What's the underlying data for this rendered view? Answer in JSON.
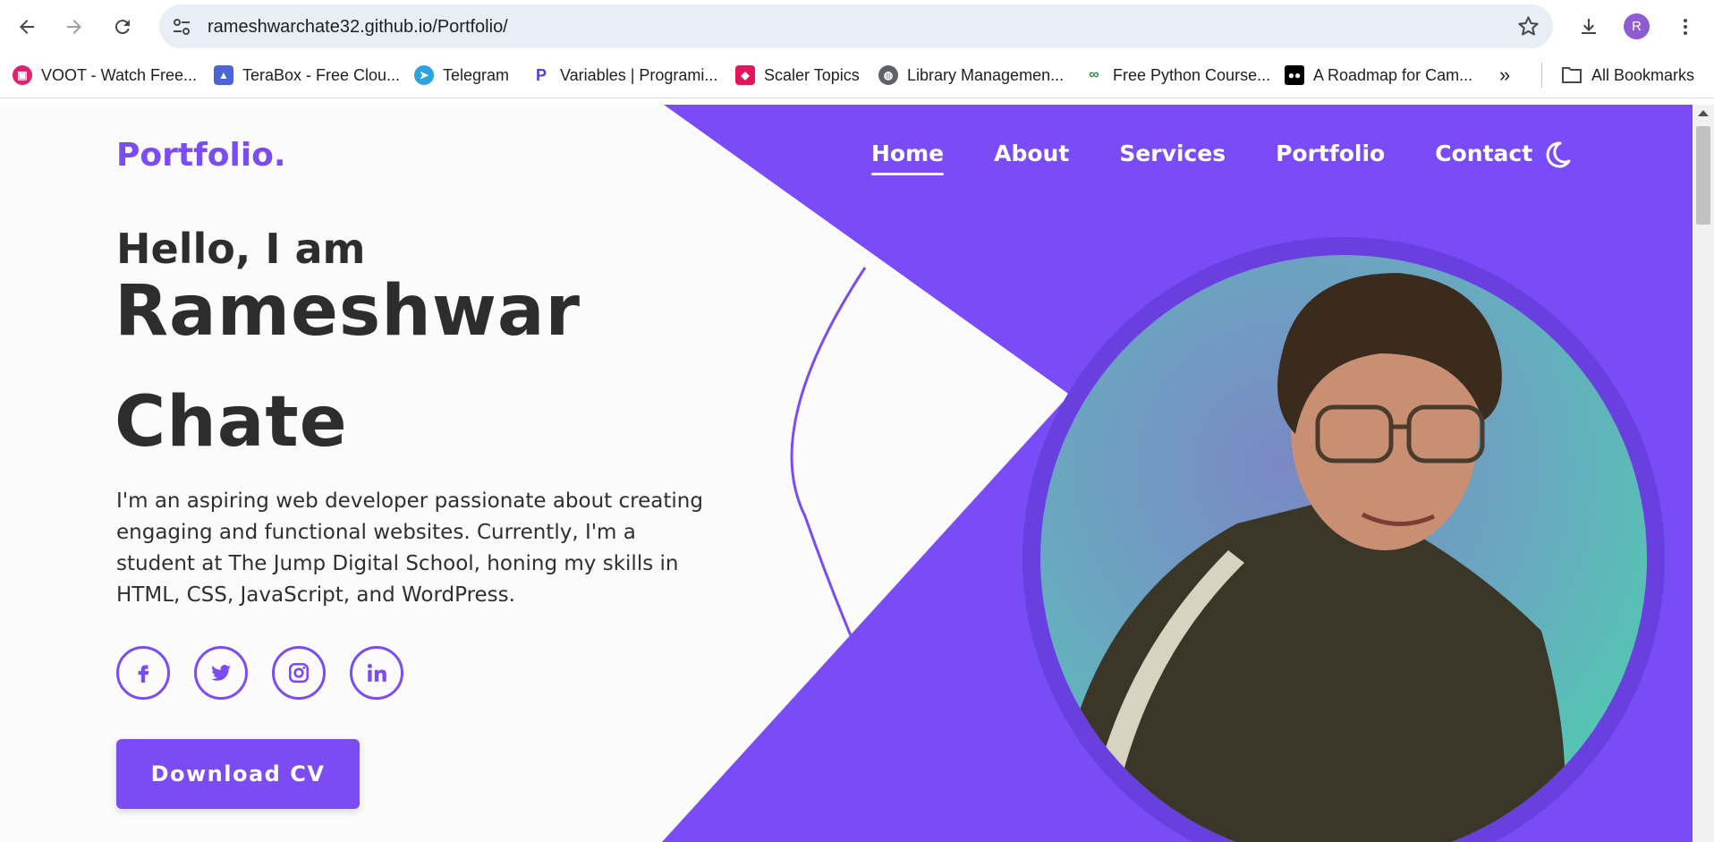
{
  "browser": {
    "url": "rameshwarchate32.github.io/Portfolio/",
    "profile_initial": "R",
    "icons": [
      "back-icon",
      "forward-icon",
      "reload-icon",
      "site-info-icon",
      "star-icon",
      "download-icon",
      "menu-dots-icon"
    ],
    "bookmarks": [
      {
        "label": "VOOT - Watch Free...",
        "icon": "voot-icon",
        "color": "#e0226f"
      },
      {
        "label": "TeraBox - Free Clou...",
        "icon": "terabox-icon",
        "color": "#4f63d9"
      },
      {
        "label": "Telegram",
        "icon": "telegram-icon",
        "color": "#2aa3df"
      },
      {
        "label": "Variables | Programi...",
        "icon": "programiz-icon",
        "color": "#5b3bd8"
      },
      {
        "label": "Scaler Topics",
        "icon": "scaler-icon",
        "color": "#e6145b"
      },
      {
        "label": "Library Managemen...",
        "icon": "globe-icon",
        "color": "#5f6368"
      },
      {
        "label": "Free Python Course...",
        "icon": "gfg-icon",
        "color": "#2f8d46"
      },
      {
        "label": "A Roadmap for Cam...",
        "icon": "medium-icon",
        "color": "#000000"
      }
    ],
    "all_bookmarks_label": "All Bookmarks"
  },
  "site": {
    "logo": "Portfolio.",
    "nav": [
      {
        "label": "Home",
        "active": true
      },
      {
        "label": "About",
        "active": false
      },
      {
        "label": "Services",
        "active": false
      },
      {
        "label": "Portfolio",
        "active": false
      },
      {
        "label": "Contact",
        "active": false
      }
    ],
    "hero": {
      "greeting": "Hello, I am",
      "name_line1": "Rameshwar",
      "name_line2": "Chate",
      "bio": "I'm an aspiring web developer passionate about creating engaging and functional websites. Currently, I'm a student at The Jump Digital School, honing my skills in HTML, CSS, JavaScript, and WordPress.",
      "socials": [
        "facebook-icon",
        "twitter-icon",
        "instagram-icon",
        "linkedin-icon"
      ],
      "cta": "Download CV"
    },
    "colors": {
      "accent": "#7b4cf4",
      "text": "#2d2d2d",
      "background": "#fbfbfb"
    }
  }
}
